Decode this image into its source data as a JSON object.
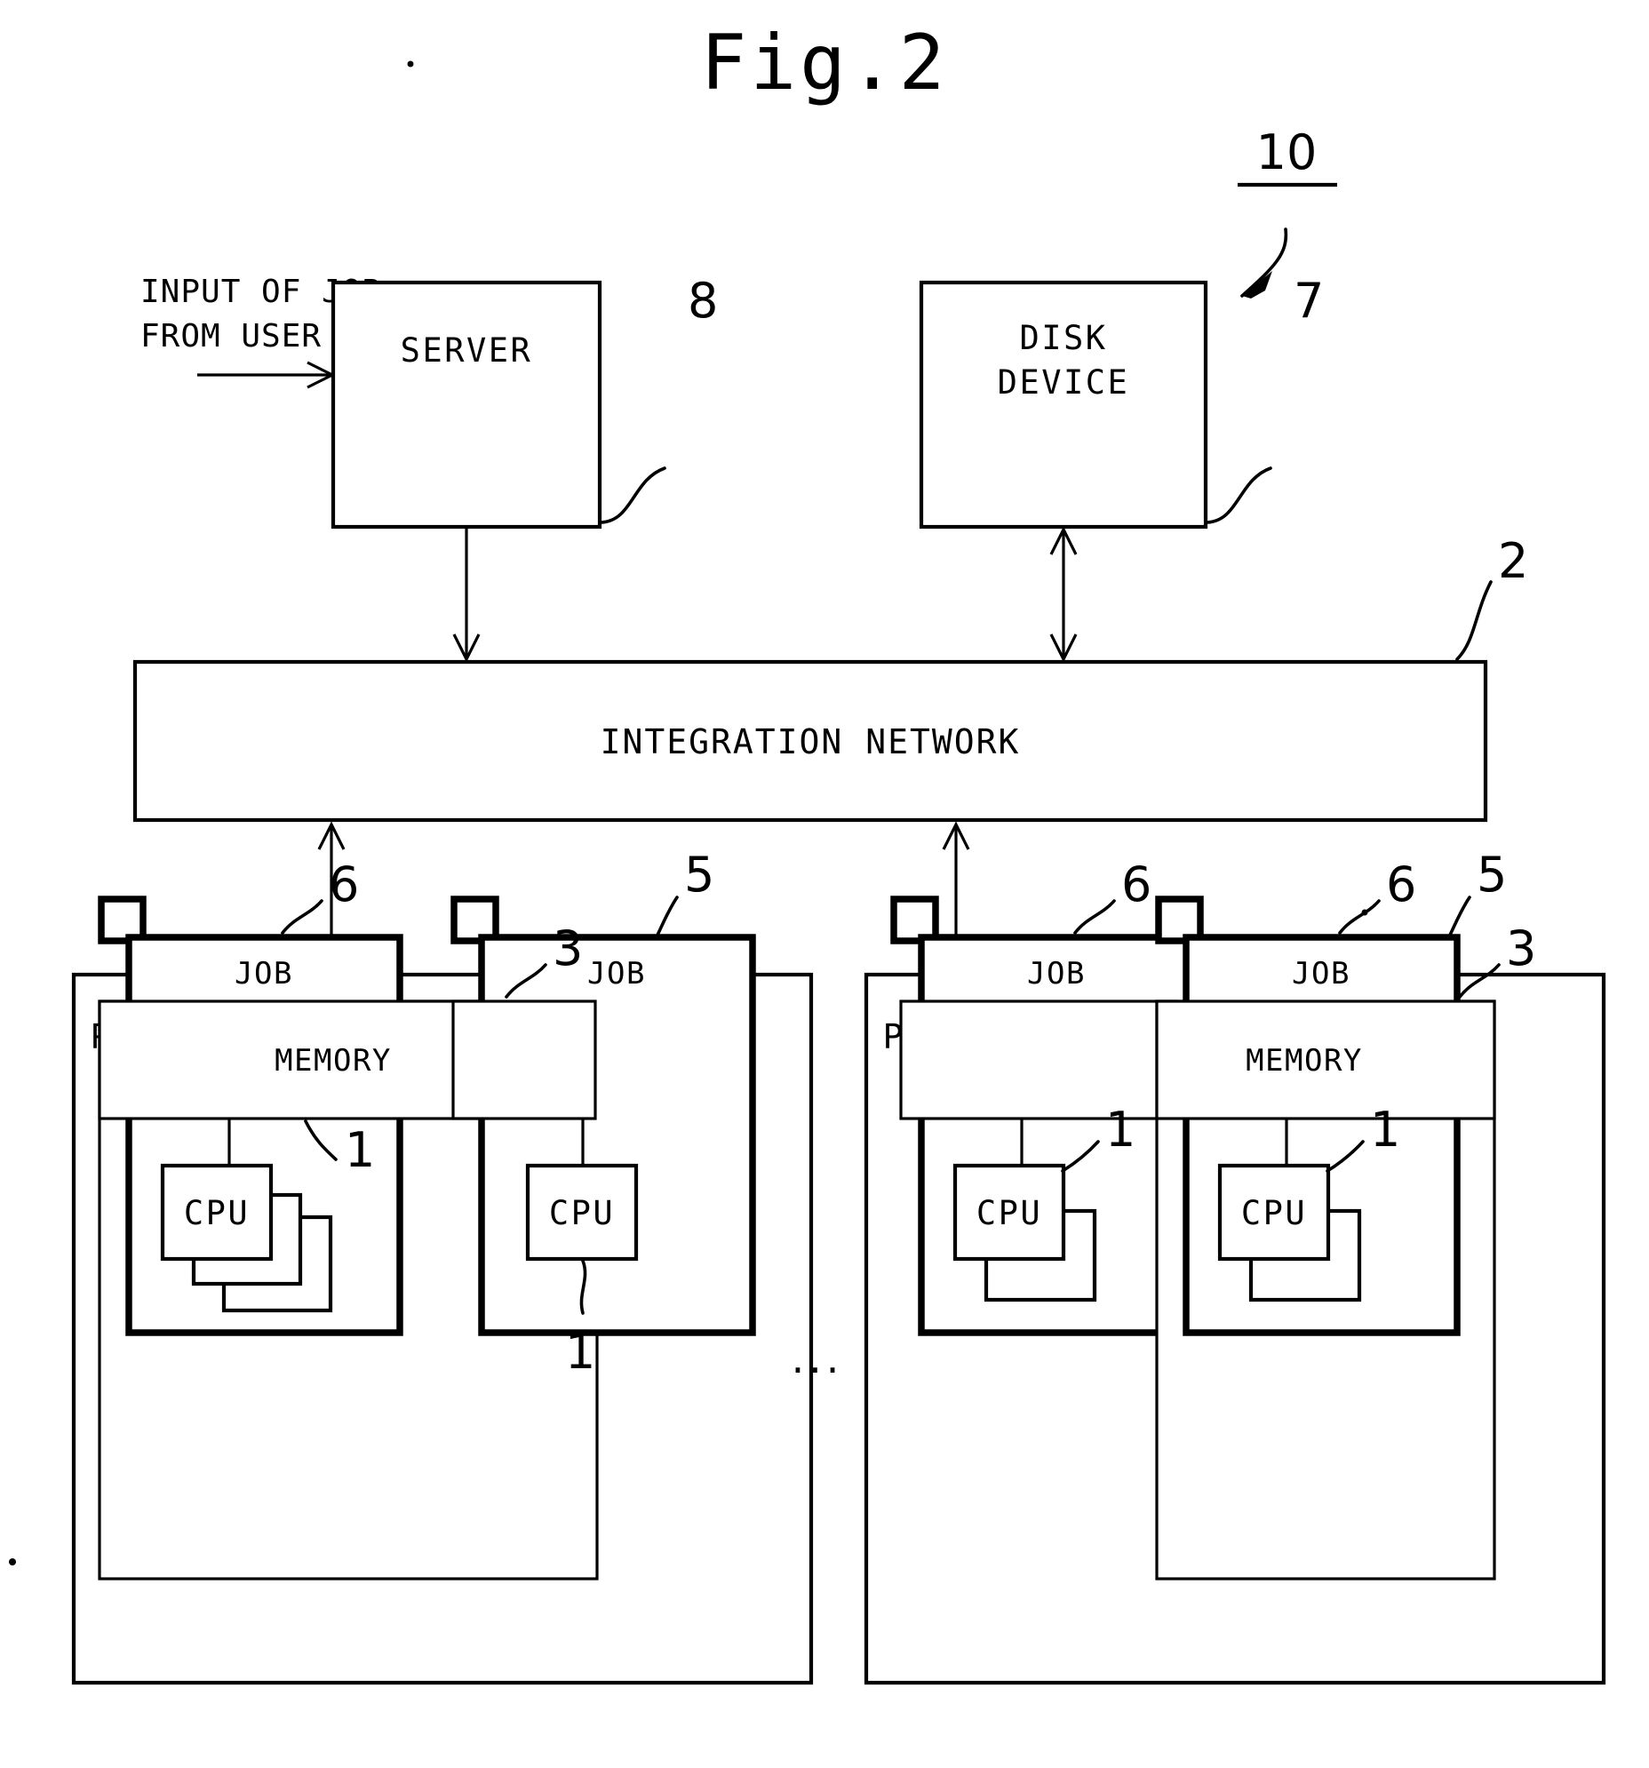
{
  "figure": {
    "title": "Fig.2",
    "caption_input": [
      "INPUT OF JOB",
      "FROM USER"
    ],
    "ellipsis": "..."
  },
  "blocks": {
    "server": {
      "label": "SERVER",
      "ref": "8"
    },
    "disk_device": {
      "label_line1": "DISK",
      "label_line2": "DEVICE",
      "ref": "7"
    },
    "integration_network": {
      "label": "INTEGRATION NETWORK",
      "ref": "2"
    },
    "system_overall_ref": "10"
  },
  "parallel_systems": [
    {
      "label": "PARALLEL COMPUTER SYSTEM",
      "ref": "5",
      "nodes": [
        {
          "job_label": "JOB",
          "job_ref": "6",
          "memory_label": "MEMORY",
          "cpu_label": "CPU",
          "cpu_ref": "1",
          "node_ref": ""
        },
        {
          "job_label": "JOB",
          "job_ref": "",
          "memory_label": "",
          "cpu_label": "CPU",
          "cpu_ref": "1",
          "node_ref": "3"
        }
      ]
    },
    {
      "label": "PARALLEL COMPUTER SYSTEM",
      "ref": "5",
      "nodes": [
        {
          "job_label": "JOB",
          "job_ref": "6",
          "memory_label": "",
          "cpu_label": "CPU",
          "cpu_ref": "1",
          "node_ref": ""
        },
        {
          "job_label": "JOB",
          "job_ref": "6",
          "memory_label": "MEMORY",
          "cpu_label": "CPU",
          "cpu_ref": "1",
          "node_ref": "3"
        }
      ]
    }
  ],
  "colors": {
    "ink": "#000000",
    "paper": "#ffffff"
  }
}
